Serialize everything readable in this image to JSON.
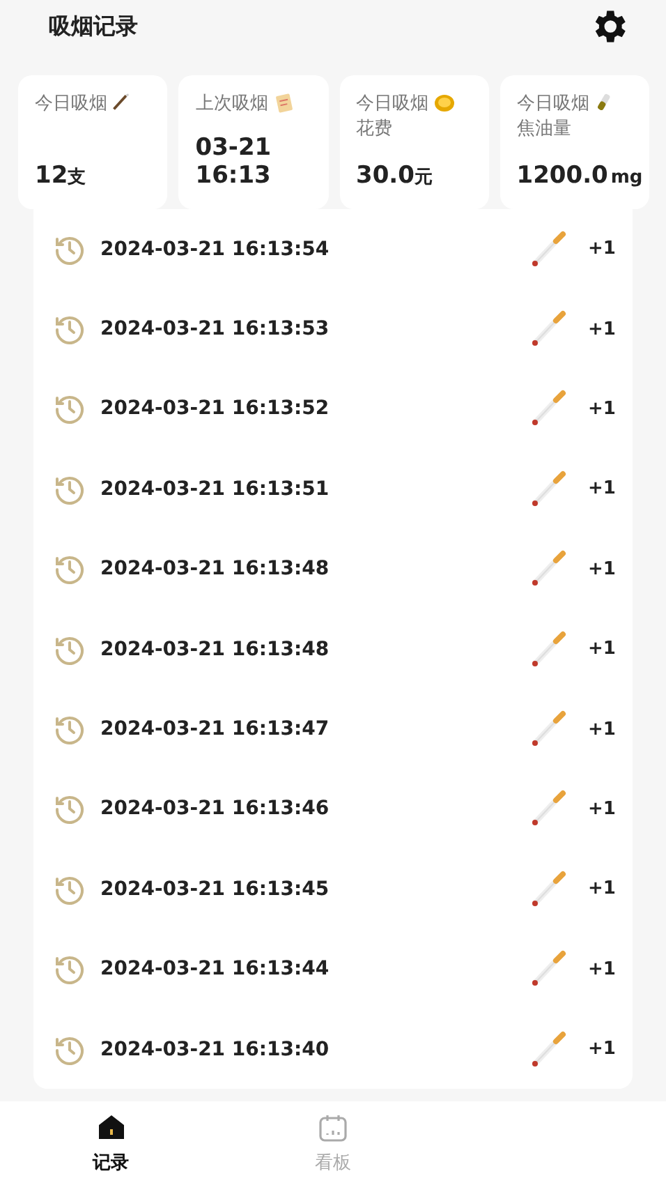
{
  "header": {
    "title": "吸烟记录"
  },
  "stats": [
    {
      "label": "今日吸烟",
      "kind": "pencil",
      "value": "12",
      "unit": "支"
    },
    {
      "label": "上次吸烟",
      "kind": "note",
      "value": "03-21 16:13"
    },
    {
      "label": "今日吸烟花费",
      "kind": "coin",
      "value": "30.0",
      "unit": "元"
    },
    {
      "label": "今日吸烟焦油量",
      "kind": "bottle",
      "value": "1200.0",
      "unit": "mg"
    }
  ],
  "records": [
    {
      "time": "2024-03-21 16:13:54",
      "count": "+1"
    },
    {
      "time": "2024-03-21 16:13:53",
      "count": "+1"
    },
    {
      "time": "2024-03-21 16:13:52",
      "count": "+1"
    },
    {
      "time": "2024-03-21 16:13:51",
      "count": "+1"
    },
    {
      "time": "2024-03-21 16:13:48",
      "count": "+1"
    },
    {
      "time": "2024-03-21 16:13:48",
      "count": "+1"
    },
    {
      "time": "2024-03-21 16:13:47",
      "count": "+1"
    },
    {
      "time": "2024-03-21 16:13:46",
      "count": "+1"
    },
    {
      "time": "2024-03-21 16:13:45",
      "count": "+1"
    },
    {
      "time": "2024-03-21 16:13:44",
      "count": "+1"
    },
    {
      "time": "2024-03-21 16:13:40",
      "count": "+1"
    }
  ],
  "nav": [
    {
      "label": "记录",
      "kind": "home",
      "selected": true
    },
    {
      "label": "看板",
      "kind": "calendar",
      "selected": false
    }
  ]
}
